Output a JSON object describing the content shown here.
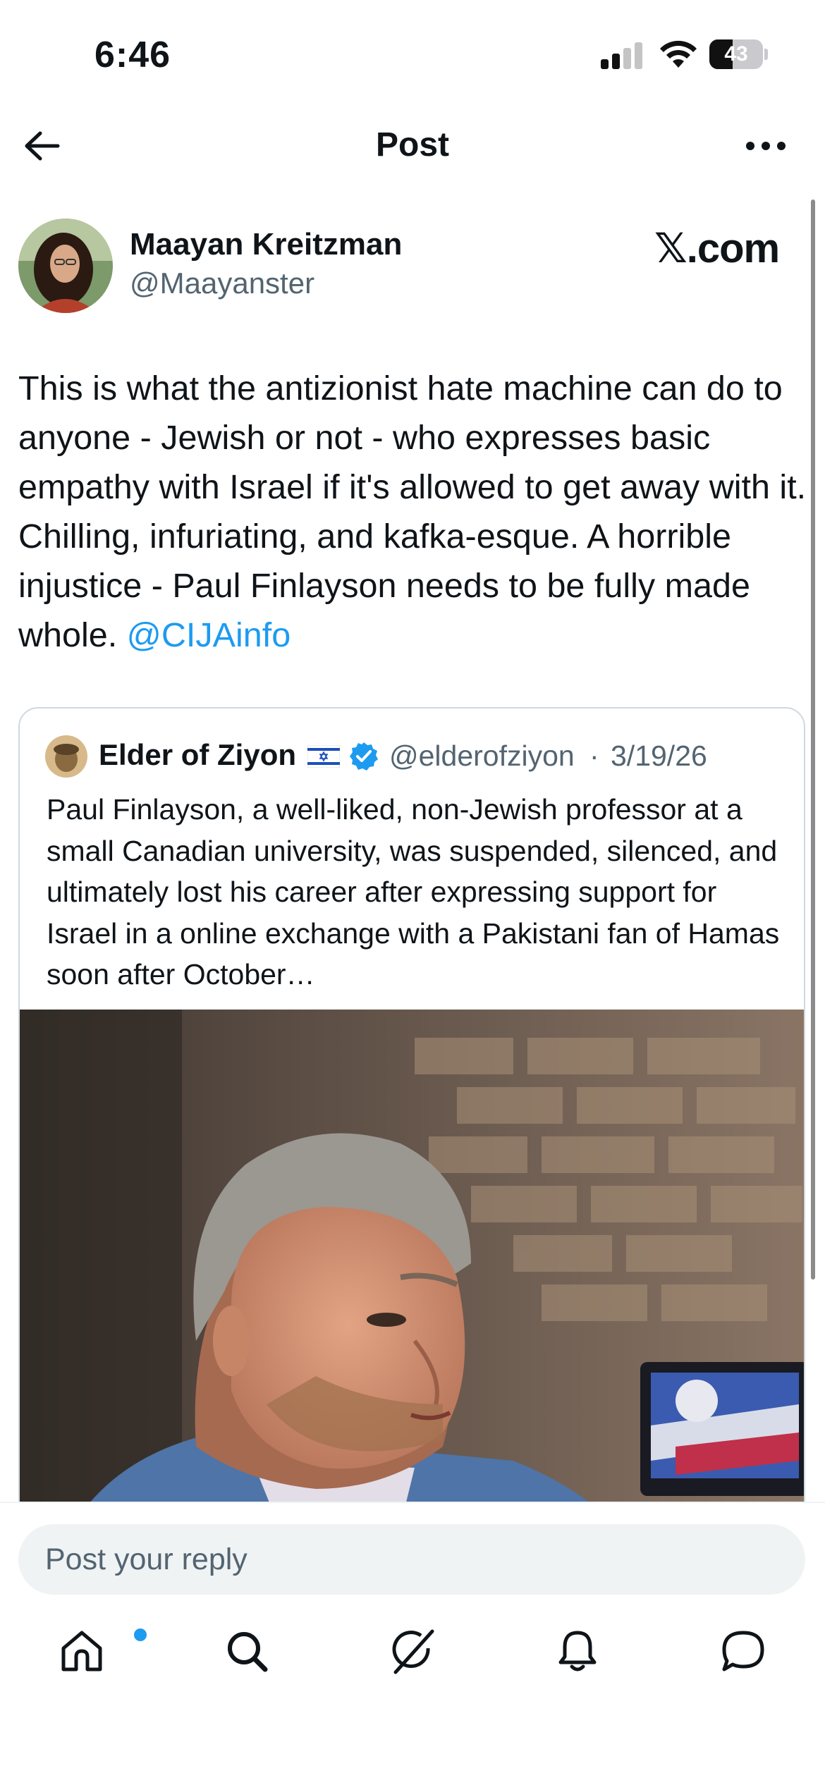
{
  "status_bar": {
    "time": "6:46",
    "battery_level": "43",
    "battery_fraction": 0.43,
    "signal_bars_active": 2,
    "signal_bars_total": 4
  },
  "header": {
    "title": "Post",
    "back_icon": "arrow-left-icon",
    "more_icon": "more-horizontal-icon"
  },
  "post": {
    "author_name": "Maayan Kreitzman",
    "author_handle": "@Maayanster",
    "source_label": "𝕏.com",
    "text": "This is what the antizionist hate machine can do to anyone - Jewish or not - who expresses basic empathy with Israel if it's allowed to get away with it. Chilling, infuriating, and kafka-esque. A horrible injustice - Paul Finlayson needs to be fully made whole. ",
    "mention": "@CIJAinfo"
  },
  "quote": {
    "author_name": "Elder of Ziyon",
    "flag_icon": "israel-flag-icon",
    "verified_icon": "verified-badge-icon",
    "author_handle": "@elderofziyon",
    "separator": "·",
    "date": "3/19/26",
    "text": "Paul Finlayson, a well-liked, non-Jewish professor at a small Canadian university,  was suspended, silenced, and ultimately lost his career after expressing support for Israel in a online exchange with a Pakistani fan of Hamas soon after October…"
  },
  "reply": {
    "placeholder": "Post your reply"
  },
  "tab_bar": {
    "items": [
      {
        "icon": "home-icon",
        "has_notification": true
      },
      {
        "icon": "search-icon",
        "has_notification": false
      },
      {
        "icon": "grok-icon",
        "has_notification": false
      },
      {
        "icon": "bell-icon",
        "has_notification": false
      },
      {
        "icon": "chat-bubble-icon",
        "has_notification": false
      }
    ]
  },
  "colors": {
    "accent": "#1d9bf0",
    "text_primary": "#0f1419",
    "text_secondary": "#536471",
    "border": "#cfd9de"
  }
}
